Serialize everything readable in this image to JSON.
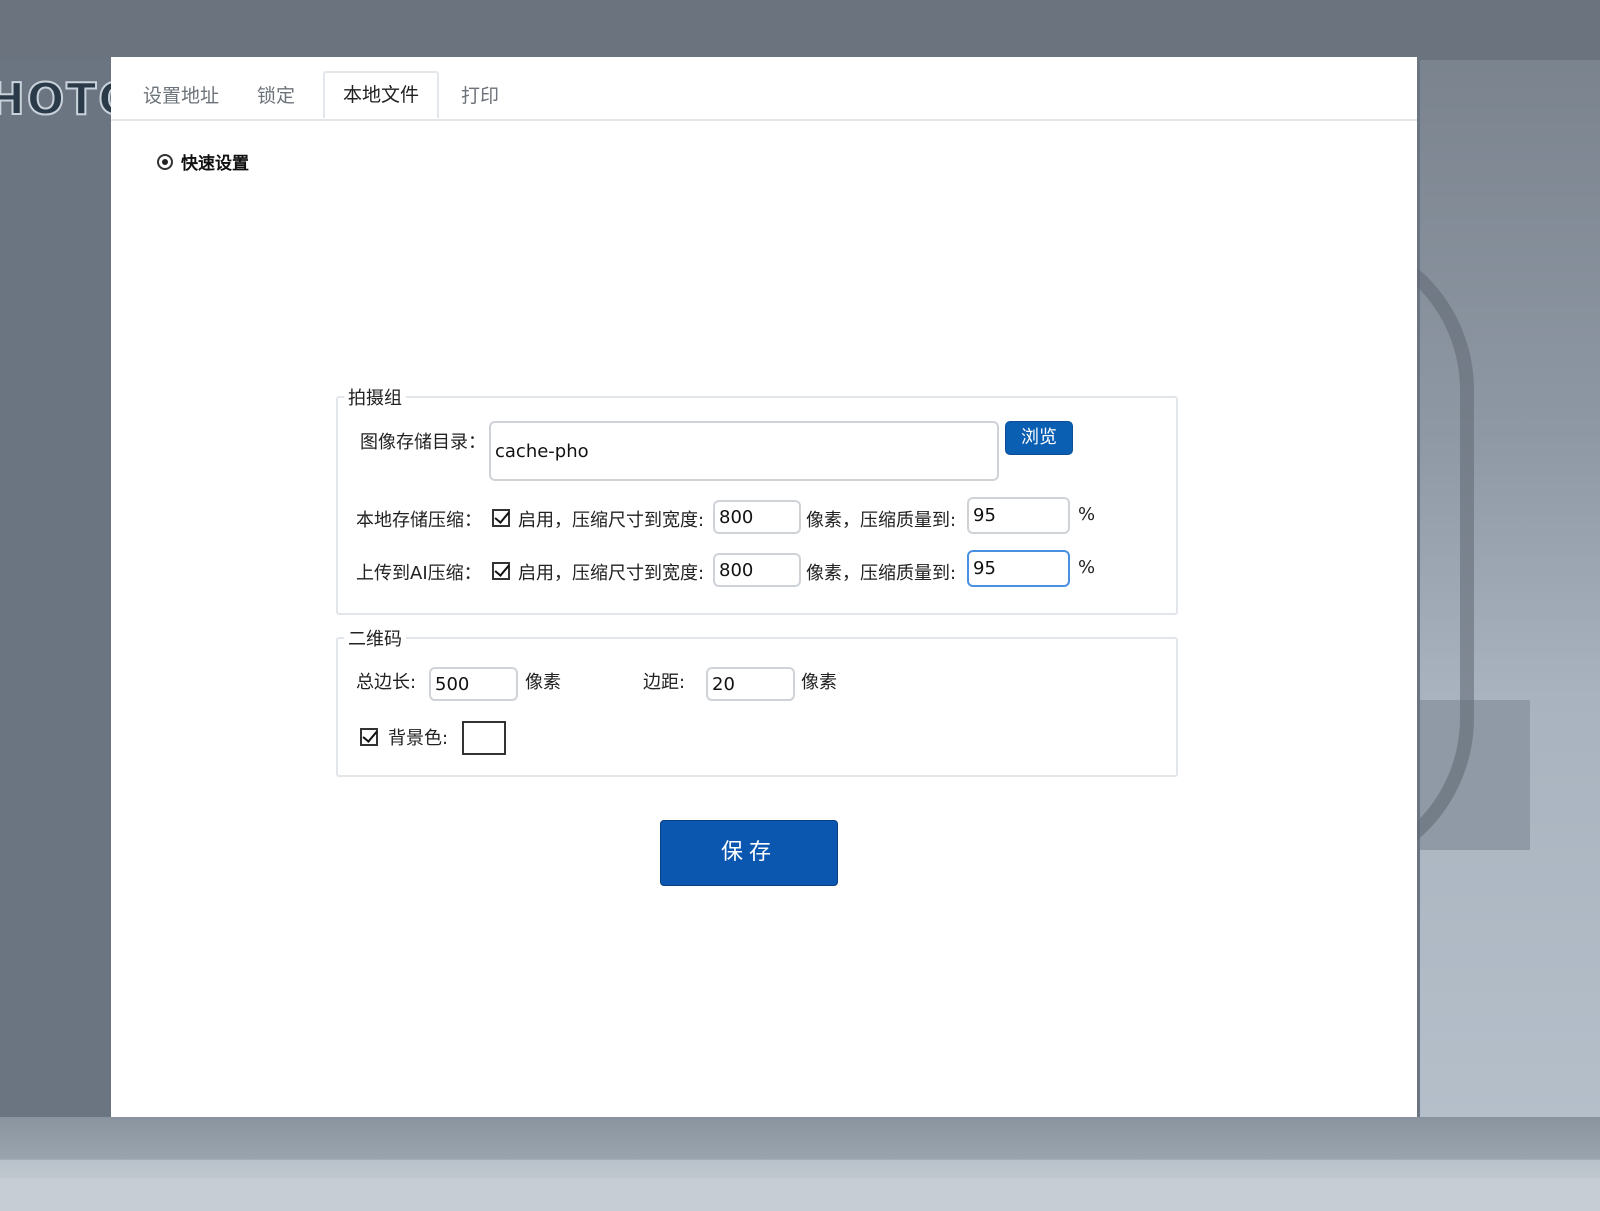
{
  "background": {
    "logo_text": "HOTO"
  },
  "tabs": [
    {
      "label": "设置地址",
      "active": false
    },
    {
      "label": "锁定",
      "active": false
    },
    {
      "label": "本地文件",
      "active": true
    },
    {
      "label": "打印",
      "active": false
    }
  ],
  "mode": {
    "label": "快速设置",
    "selected": true
  },
  "capture_group": {
    "legend": "拍摄组",
    "image_dir_label": "图像存储目录：",
    "image_dir_value": "cache-pho",
    "browse_label": "浏览",
    "local_compress": {
      "label": "本地存储压缩：",
      "enabled": true,
      "enable_text": "启用，压缩尺寸到宽度:",
      "width_value": "800",
      "quality_text": "像素，压缩质量到:",
      "quality_value": "95",
      "percent": "%"
    },
    "ai_compress": {
      "label": "上传到AI压缩：",
      "enabled": true,
      "enable_text": "启用，压缩尺寸到宽度:",
      "width_value": "800",
      "quality_text": "像素，压缩质量到:",
      "quality_value": "95",
      "percent": "%"
    }
  },
  "qr_group": {
    "legend": "二维码",
    "side_label": "总边长:",
    "side_value": "500",
    "side_unit": "像素",
    "margin_label": "边距:",
    "margin_value": "20",
    "margin_unit": "像素",
    "bg_enabled": true,
    "bg_label": "背景色:",
    "bg_color": "#ffffff"
  },
  "save_label": "保存",
  "colors": {
    "primary": "#0b57b0",
    "focus_border": "#4a90e2"
  }
}
